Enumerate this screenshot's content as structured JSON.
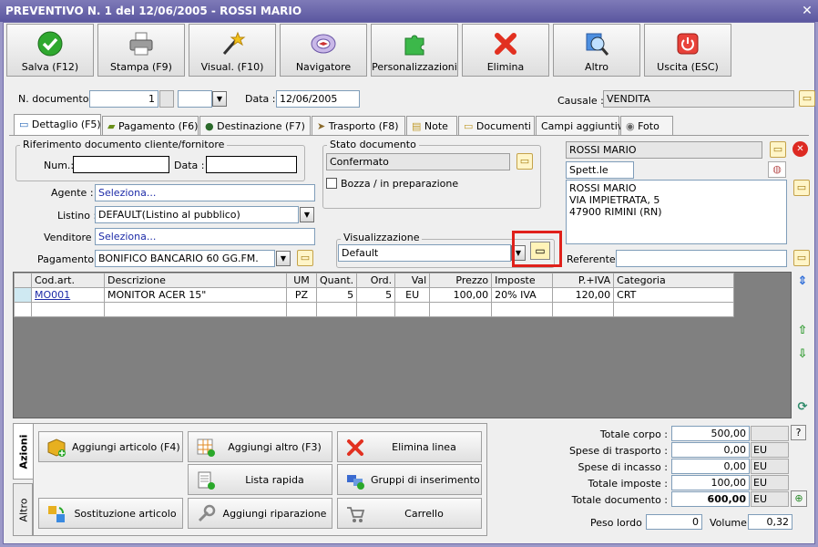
{
  "window": {
    "title": "PREVENTIVO N. 1 del 12/06/2005 - ROSSI MARIO"
  },
  "toolbar": [
    {
      "label": "Salva (F12)",
      "icon": "checkmark-icon"
    },
    {
      "label": "Stampa (F9)",
      "icon": "printer-icon"
    },
    {
      "label": "Visual. (F10)",
      "icon": "magic-wand-icon"
    },
    {
      "label": "Navigatore",
      "icon": "compass-icon"
    },
    {
      "label": "Personalizzazioni",
      "icon": "puzzle-icon"
    },
    {
      "label": "Elimina",
      "icon": "red-x-icon"
    },
    {
      "label": "Altro",
      "icon": "magnifier-icon"
    },
    {
      "label": "Uscita (ESC)",
      "icon": "power-icon"
    }
  ],
  "header": {
    "num_doc_label": "N. documento :",
    "num_doc_value": "1",
    "data_label": "Data :",
    "data_value": "12/06/2005",
    "causale_label": "Causale :",
    "causale_value": "VENDITA"
  },
  "tabs": [
    "Dettaglio (F5)",
    "Pagamento (F6)",
    "Destinazione (F7)",
    "Trasporto (F8)",
    "Note",
    "Documenti",
    "Campi aggiuntivi",
    "Foto"
  ],
  "riferimento": {
    "title": "Riferimento documento cliente/fornitore",
    "num_label": "Num.:",
    "num_value": "",
    "data_label": "Data :",
    "data_value": ""
  },
  "stato": {
    "title": "Stato documento",
    "value": "Confermato",
    "bozza_label": "Bozza / in preparazione"
  },
  "fields": {
    "agente_label": "Agente :",
    "agente_value": "Seleziona...",
    "listino_label": "Listino :",
    "listino_value": "DEFAULT(Listino al pubblico)",
    "venditore_label": "Venditore :",
    "venditore_value": "Seleziona...",
    "pagamento_label": "Pagamento :",
    "pagamento_value": "BONIFICO BANCARIO 60 GG.FM."
  },
  "visualizzazione": {
    "title": "Visualizzazione",
    "value": "Default"
  },
  "customer": {
    "name": "ROSSI MARIO",
    "salutation": "Spett.le",
    "address_lines": [
      "ROSSI MARIO",
      "VIA IMPIETRATA, 5",
      "47900 RIMINI (RN)"
    ],
    "referente_label": "Referente",
    "referente_value": ""
  },
  "table": {
    "columns": [
      "Cod.art.",
      "Descrizione",
      "UM",
      "Quant.",
      "Ord.",
      "Val",
      "Prezzo",
      "Imposte",
      "P.+IVA",
      "Categoria"
    ],
    "rows": [
      [
        "MO001",
        "MONITOR ACER 15\"",
        "PZ",
        "5",
        "5",
        "EU",
        "100,00",
        "20% IVA",
        "120,00",
        "CRT"
      ]
    ]
  },
  "side_tabs": [
    "Azioni",
    "Altro"
  ],
  "actions": [
    {
      "label": "Aggiungi articolo (F4)",
      "icon": "add-box-icon"
    },
    {
      "label": "Aggiungi altro (F3)",
      "icon": "add-grid-icon"
    },
    {
      "label": "Elimina linea",
      "icon": "delete-x-icon"
    },
    {
      "label": "Lista rapida",
      "icon": "quick-list-icon"
    },
    {
      "label": "Gruppi di inserimento",
      "icon": "group-insert-icon"
    },
    {
      "label": "Sostituzione articolo",
      "icon": "replace-icon"
    },
    {
      "label": "Aggiungi riparazione",
      "icon": "wrench-icon"
    },
    {
      "label": "Carrello",
      "icon": "cart-icon"
    }
  ],
  "totals": {
    "corpo_label": "Totale corpo :",
    "corpo_value": "500,00",
    "trasporto_label": "Spese di trasporto :",
    "trasporto_value": "0,00",
    "trasporto_cur": "EU",
    "incasso_label": "Spese di incasso :",
    "incasso_value": "0,00",
    "incasso_cur": "EU",
    "imposte_label": "Totale imposte :",
    "imposte_value": "100,00",
    "imposte_cur": "EU",
    "documento_label": "Totale documento :",
    "documento_value": "600,00",
    "documento_cur": "EU",
    "help_label": "?",
    "peso_label": "Peso lordo :",
    "peso_value": "0",
    "volume_label": "Volume :",
    "volume_value": "0,32"
  },
  "colors": {
    "accent": "#6a66ad",
    "highlight_border": "#e0201a",
    "link": "#1d2ba8"
  }
}
